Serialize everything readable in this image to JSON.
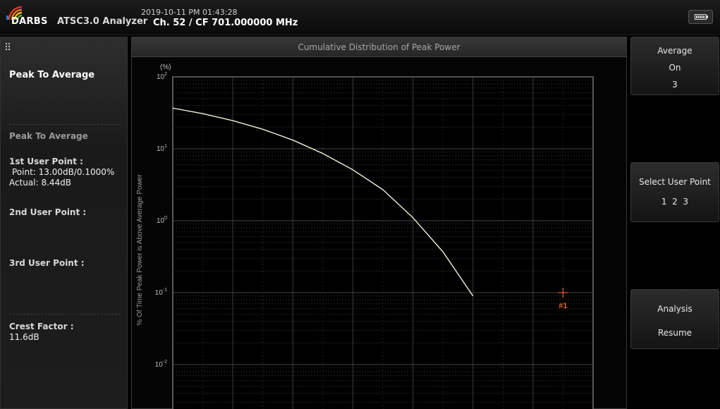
{
  "header": {
    "brand": "DARBS",
    "app_title": "ATSC3.0 Analyzer",
    "datetime": "2019-10-11 PM 01:43:28",
    "channel": "Ch. 52 / CF 701.000000 MHz",
    "brand_colors": [
      "#e03a1e",
      "#f07a1a",
      "#f2c21a",
      "#5fae3e",
      "#2f7fd0"
    ]
  },
  "left_panel": {
    "heading": "Peak To Average",
    "section_title": "Peak To Average",
    "user_point_1": {
      "label": "1st User Point :",
      "point": "Point: 13.00dB/0.1000%",
      "actual": "Actual: 8.44dB"
    },
    "user_point_2": {
      "label": "2nd User Point :"
    },
    "user_point_3": {
      "label": "3rd User Point :"
    },
    "crest": {
      "label": "Crest Factor :",
      "value": "11.6dB"
    }
  },
  "chart": {
    "title": "Cumulative Distribution of Peak Power",
    "y_unit": "(%)",
    "y_axis_label": "% Of Time Peak Power is Above Average Power",
    "marker_label": "#1",
    "marker_color": "#e5632a",
    "curve_color": "#efefd6"
  },
  "chart_data": {
    "type": "line",
    "title": "Cumulative Distribution of Peak Power",
    "ylabel": "% Of Time Peak Power is Above Average Power",
    "y_scale": "log",
    "ylim": [
      0.01,
      100
    ],
    "yticks": [
      {
        "value": 100,
        "base": "10",
        "exp": "2"
      },
      {
        "value": 10,
        "base": "10",
        "exp": "1"
      },
      {
        "value": 1,
        "base": "10",
        "exp": "0"
      },
      {
        "value": 0.1,
        "base": "10",
        "exp": "-1"
      },
      {
        "value": 0.01,
        "base": "10",
        "exp": "-2"
      }
    ],
    "xlim": [
      0,
      14
    ],
    "grid": true,
    "series": [
      {
        "x": [
          0,
          1,
          2,
          3,
          4,
          5,
          6,
          7,
          8,
          9,
          10
        ],
        "y": [
          36.8,
          30.8,
          24.6,
          18.7,
          13.2,
          8.6,
          5.1,
          2.7,
          1.1,
          0.37,
          0.09
        ]
      }
    ],
    "user_point": {
      "name": "#1",
      "x": 13.0,
      "y": 0.1
    }
  },
  "right_panel": {
    "average": {
      "title": "Average",
      "state": "On",
      "count": "3"
    },
    "select_user_point": {
      "title": "Select User Point",
      "options": "1  2  3"
    },
    "analysis": {
      "title": "Analysis",
      "state": "Resume"
    }
  }
}
